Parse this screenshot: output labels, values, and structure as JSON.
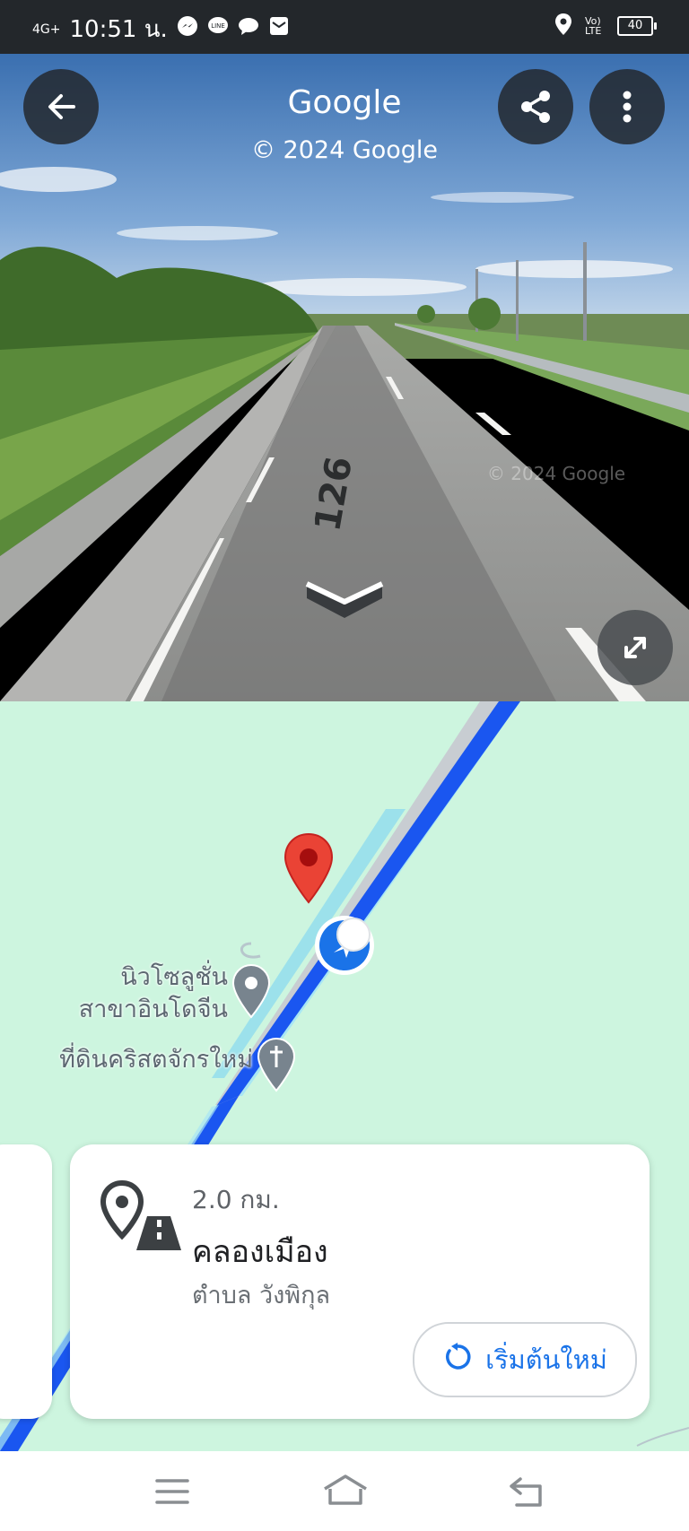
{
  "status_bar": {
    "network": "4G+",
    "time": "10:51 น.",
    "volte_label": "Vo) LTE",
    "battery": "40",
    "notification_icons": [
      "messenger-icon",
      "line-icon",
      "chat-icon",
      "mail-icon"
    ],
    "right_icons": [
      "location-icon",
      "volte-icon",
      "battery-icon"
    ]
  },
  "street_view": {
    "title": "Google",
    "copyright": "© 2024 Google",
    "road_number": "126",
    "watermark": "© 2024 Google",
    "icons": {
      "back": "back-arrow-icon",
      "share": "share-icon",
      "more": "more-vert-icon",
      "move_forward": "chevron-down-icon",
      "expand": "expand-icon"
    }
  },
  "map": {
    "poi_1": {
      "line1": "นิวโซลูชั่น",
      "line2": "สาขาอินโดจีน",
      "icon": "place-pin-icon"
    },
    "poi_2": {
      "label": "ที่ดินคริสตจักรใหม่",
      "icon": "church-icon"
    },
    "marker": "red-location-marker",
    "current_position": "position-arrow-icon",
    "colors": {
      "map_bg": "#cdf5df",
      "route": "#1a56f0",
      "marker": "#ea4335"
    }
  },
  "place_card": {
    "distance": "2.0 กม.",
    "name": "คลองเมือง",
    "subtitle": "ตำบล วังพิกุล",
    "icon": "place-road-icon",
    "restart_button": "เริ่มต้นใหม่",
    "restart_icon": "restart-icon"
  },
  "nav_bar": {
    "icons": [
      "menu-icon",
      "home-icon",
      "back-icon"
    ]
  }
}
